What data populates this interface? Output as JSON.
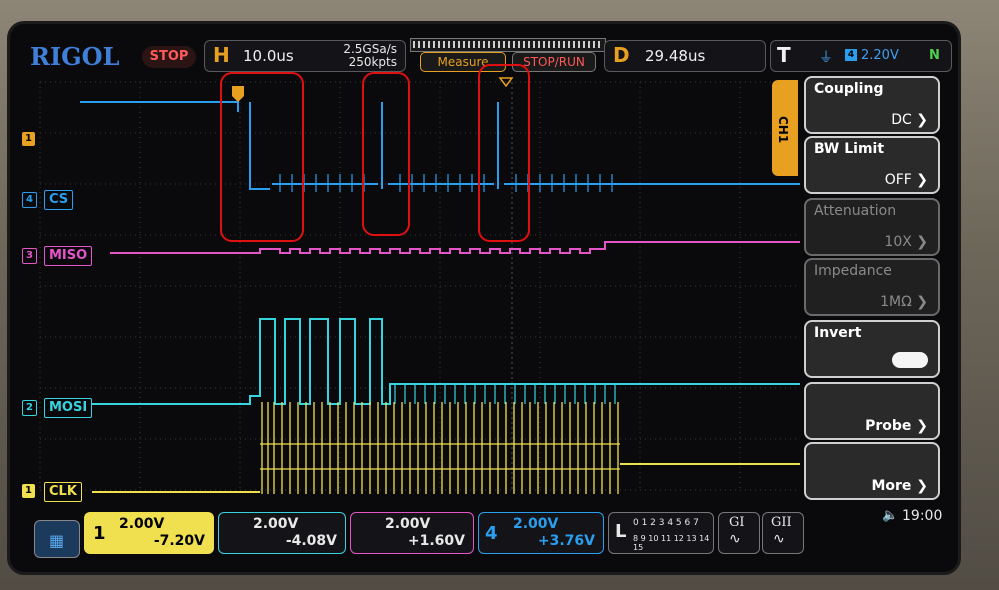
{
  "brand": "RIGOL",
  "run_state": "STOP",
  "horizontal": {
    "letter": "H",
    "timebase": "10.0us",
    "sample_rate": "2.5GSa/s",
    "memory_depth": "250kpts"
  },
  "delay": {
    "letter": "D",
    "value": "29.48us"
  },
  "trigger": {
    "letter": "T",
    "level": "2.20V",
    "mode": "N"
  },
  "soft_buttons": {
    "measure": "Measure",
    "stop_run": "STOP/RUN"
  },
  "menu": {
    "channel": "CH1",
    "items": [
      {
        "label": "Coupling",
        "value": "DC"
      },
      {
        "label": "BW Limit",
        "value": "OFF"
      },
      {
        "label": "Attenuation",
        "value": "10X"
      },
      {
        "label": "Impedance",
        "value": "1MΩ"
      },
      {
        "label": "Invert",
        "value": ""
      },
      {
        "label": "Probe",
        "value": ""
      },
      {
        "label": "More",
        "value": ""
      }
    ]
  },
  "channels": {
    "cs": {
      "num": "4",
      "name": "CS",
      "color": "#2a9ff0"
    },
    "miso": {
      "num": "3",
      "name": "MISO",
      "color": "#e455c8"
    },
    "mosi": {
      "num": "2",
      "name": "MOSI",
      "color": "#37d4e0"
    },
    "clk": {
      "num": "1",
      "name": "CLK",
      "color": "#f0e050"
    }
  },
  "bottom": {
    "ch1": {
      "num": "1",
      "scale": "2.00V",
      "offset": "-7.20V"
    },
    "ch2": {
      "scale": "2.00V",
      "offset": "-4.08V"
    },
    "ch3": {
      "scale": "2.00V",
      "offset": "+1.60V"
    },
    "ch4": {
      "num": "4",
      "scale": "2.00V",
      "offset": "+3.76V"
    },
    "la": {
      "letter": "L",
      "row1": "0 1 2 3  4 5 6 7",
      "row2": "8 9 10 11 12 13 14 15"
    },
    "gen1": "GI",
    "gen2": "GII",
    "clock": "19:00"
  }
}
